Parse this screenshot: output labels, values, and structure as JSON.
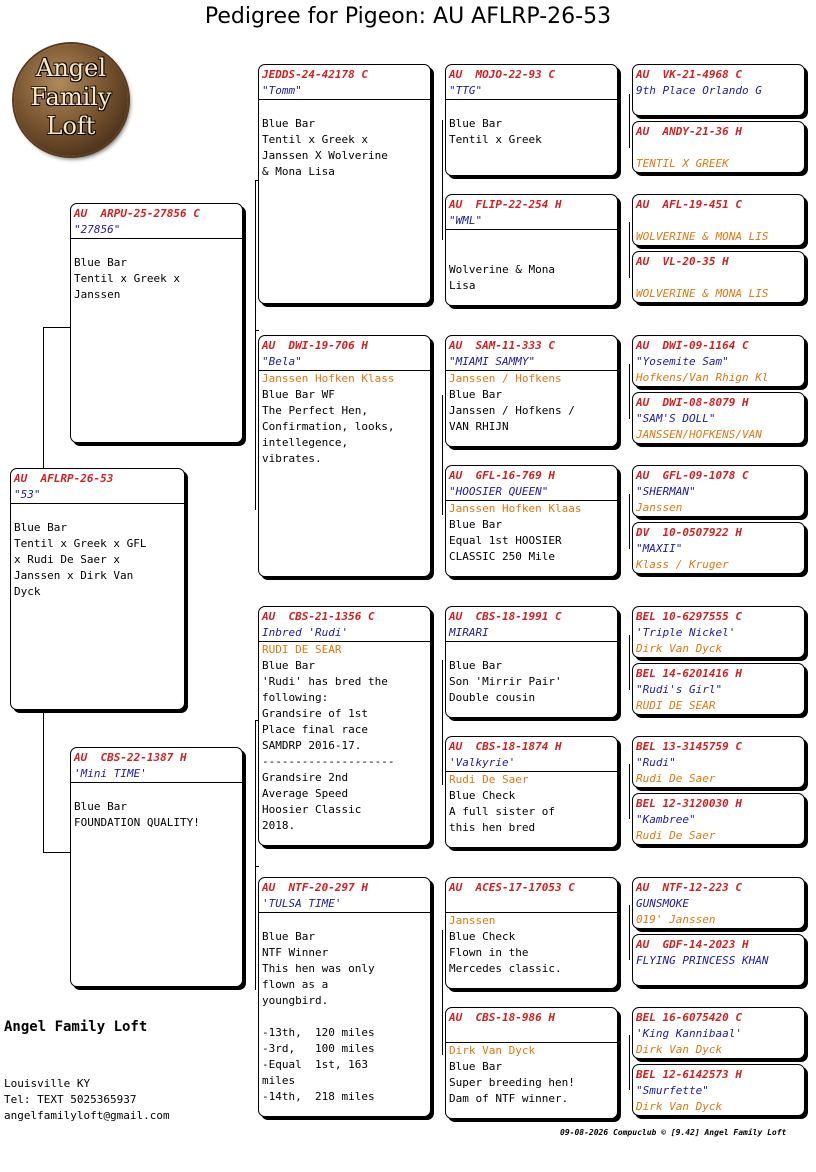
{
  "title": "Pedigree for Pigeon: AU  AFLRP-26-53",
  "logo": {
    "text": "Angel Family Loft"
  },
  "subject": {
    "ring": "AU  AFLRP-26-53",
    "name": "\"53\"",
    "body": "Blue Bar\nTentil x Greek x GFL\nx Rudi De Saer x\nJanssen x Dirk Van\nDyck"
  },
  "sire": {
    "ring": "AU  ARPU-25-27856 C",
    "name": "\"27856\"",
    "body": "Blue Bar\nTentil x Greek x\nJanssen"
  },
  "dam": {
    "ring": "AU  CBS-22-1387 H",
    "name": "'Mini TIME'",
    "body": "Blue Bar\nFOUNDATION QUALITY!"
  },
  "ss": {
    "ring": "JEDDS-24-42178 C",
    "name": "\"Tomm\"",
    "line": "",
    "body": "Blue Bar\nTentil x Greek x\nJanssen X Wolverine\n& Mona Lisa"
  },
  "sd": {
    "ring": "AU  DWI-19-706 H",
    "name": "\"Bela\"",
    "line": "Janssen Hofken Klass",
    "body": "Blue Bar WF\nThe Perfect Hen,\nConfirmation, looks,\nintellegence,\nvibrates."
  },
  "ds": {
    "ring": "AU  CBS-21-1356 C",
    "name": "Inbred 'Rudi'",
    "line": "RUDI DE SEAR",
    "body": "Blue Bar\n'Rudi' has bred the\nfollowing:\nGrandsire of 1st\nPlace final race\nSAMDRP 2016-17.\n--------------------\nGrandsire 2nd\nAverage Speed\nHoosier Classic\n2018."
  },
  "dd": {
    "ring": "AU  NTF-20-297 H",
    "name": "'TULSA TIME'",
    "line": "",
    "body": "Blue Bar\nNTF Winner\nThis hen was only\nflown as a\nyoungbird.\n\n-13th,  120 miles\n-3rd,   100 miles\n-Equal  1st, 163\nmiles\n-14th,  218 miles"
  },
  "sss": {
    "ring": "AU  MOJO-22-93 C",
    "name": "\"TTG\"",
    "line": "",
    "body": "Blue Bar\nTentil x Greek"
  },
  "ssd": {
    "ring": "AU  FLIP-22-254 H",
    "name": "\"WML\"",
    "line": "",
    "body": "Wolverine & Mona\nLisa"
  },
  "sds": {
    "ring": "AU  SAM-11-333 C",
    "name": "\"MIAMI SAMMY\"",
    "line": "Janssen / Hofkens",
    "body": "Blue Bar\nJanssen / Hofkens /\nVAN RHIJN"
  },
  "sdd": {
    "ring": "AU  GFL-16-769 H",
    "name": "\"HOOSIER QUEEN\"",
    "line": "Janssen Hofken Klaas",
    "body": "Blue Bar\nEqual 1st HOOSIER\nCLASSIC 250 Mile"
  },
  "dss": {
    "ring": "AU  CBS-18-1991 C",
    "name": "MIRARI",
    "line": "",
    "body": "Blue Bar\nSon 'Mirrir Pair'\nDouble cousin"
  },
  "dsd": {
    "ring": "AU  CBS-18-1874 H",
    "name": "'Valkyrie'",
    "line": "Rudi De Saer",
    "body": "Blue Check\nA full sister of\nthis hen bred"
  },
  "dds": {
    "ring": "AU  ACES-17-17053 C",
    "name": "",
    "line": "Janssen",
    "body": "Blue Check\nFlown in the\nMercedes classic."
  },
  "ddd": {
    "ring": "AU  CBS-18-986 H",
    "name": "",
    "line": "Dirk Van Dyck",
    "body": "Blue Bar\nSuper breeding hen!\nDam of NTF winner."
  },
  "g4": [
    {
      "ring": "AU  VK-21-4968 C",
      "name": "9th Place Orlando G",
      "strain": ""
    },
    {
      "ring": "AU  ANDY-21-36 H",
      "name": "",
      "strain": "TENTIL X GREEK"
    },
    {
      "ring": "AU  AFL-19-451 C",
      "name": "",
      "strain": "WOLVERINE & MONA LIS"
    },
    {
      "ring": "AU  VL-20-35 H",
      "name": "",
      "strain": "WOLVERINE & MONA LIS"
    },
    {
      "ring": "AU  DWI-09-1164 C",
      "name": "\"Yosemite Sam\"",
      "strain": "Hofkens/Van Rhign Kl"
    },
    {
      "ring": "AU  DWI-08-8079 H",
      "name": "\"SAM'S DOLL\"",
      "strain": "JANSSEN/HOFKENS/VAN"
    },
    {
      "ring": "AU  GFL-09-1078 C",
      "name": "\"SHERMAN\"",
      "strain": "Janssen"
    },
    {
      "ring": "DV  10-0507922 H",
      "name": "\"MAXII\"",
      "strain": "Klass / Kruger"
    },
    {
      "ring": "BEL 10-6297555 C",
      "name": "'Triple Nickel'",
      "strain": "Dirk Van Dyck"
    },
    {
      "ring": "BEL 14-6201416 H",
      "name": "\"Rudi's Girl\"",
      "strain": "RUDI DE SEAR"
    },
    {
      "ring": "BEL 13-3145759 C",
      "name": "\"Rudi\"",
      "strain": "Rudi De Saer"
    },
    {
      "ring": "BEL 12-3120030 H",
      "name": "\"Kambree\"",
      "strain": "Rudi De Saer"
    },
    {
      "ring": "AU  NTF-12-223 C",
      "name": "GUNSMOKE",
      "strain": "019' Janssen"
    },
    {
      "ring": "AU  GDF-14-2023 H",
      "name": "FLYING PRINCESS KHAN",
      "strain": ""
    },
    {
      "ring": "BEL 16-6075420 C",
      "name": "'King Kannibaal'",
      "strain": "Dirk Van Dyck"
    },
    {
      "ring": "BEL 12-6142573 H",
      "name": "\"Smurfette\"",
      "strain": "Dirk Van Dyck"
    }
  ],
  "footer": {
    "loft_name": "Angel Family Loft",
    "info": "Louisville KY\nTel: TEXT 5025365937\nangelfamilyloft@gmail.com",
    "stamp": "09-08-2026   Compuclub © [9.42]  Angel Family Loft"
  },
  "colors": {
    "ring": "#d42020",
    "name": "#1a1aaa",
    "strain": "#e07810"
  }
}
